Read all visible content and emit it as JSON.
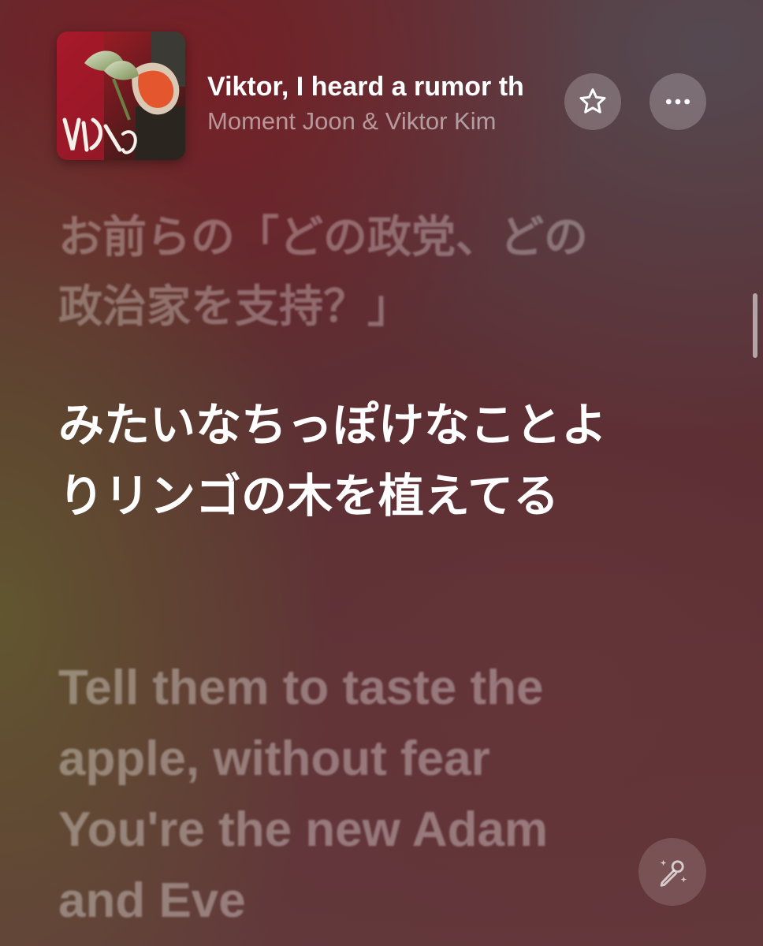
{
  "now_playing": {
    "title": "Viktor, I heard a rumor th",
    "artist": "Moment Joon & Viktor Kim",
    "artwork_text": "Viktor Kim",
    "icons": {
      "favorite": "star-outline-icon",
      "more": "ellipsis-icon"
    }
  },
  "lyrics": {
    "previous": "お前らの「どの政党、どの政治家を支持？」",
    "current": "みたいなちっぽけなことよりリンゴの木を植えてる",
    "next": "Tell them to taste the apple, without fear You're the new Adam and Eve"
  },
  "controls": {
    "sing_icon": "microphone-sparkle-icon"
  },
  "colors": {
    "background": "#5b2e33",
    "current_lyric": "#ffffff",
    "dim_lyric": "rgba(255,255,255,0.32)"
  }
}
